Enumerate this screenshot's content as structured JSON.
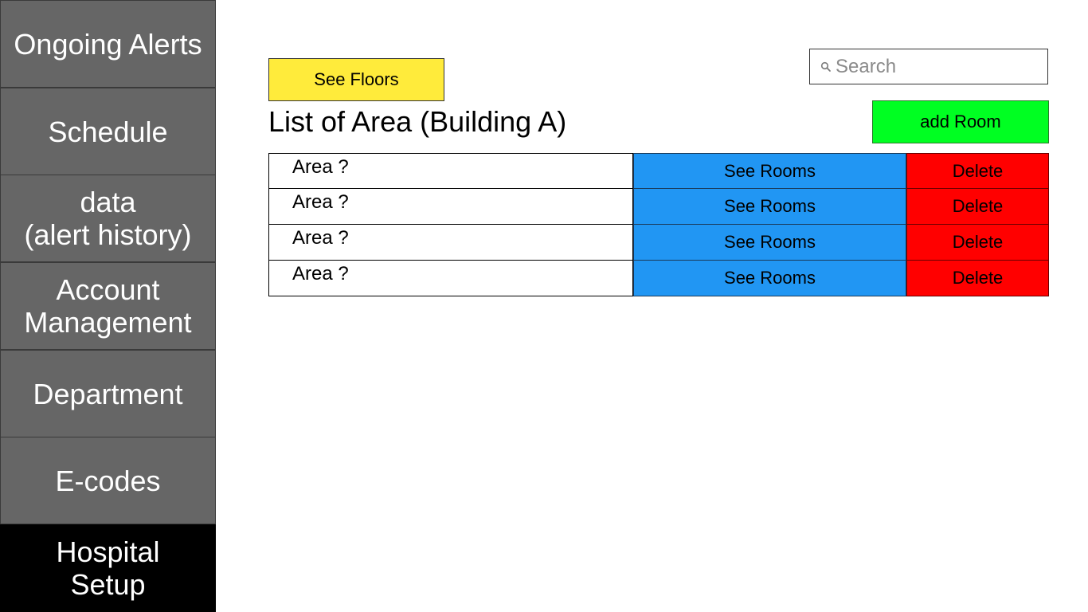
{
  "sidebar": {
    "items": [
      {
        "label": "Ongoing Alerts",
        "active": false
      },
      {
        "label": "Schedule",
        "active": false
      },
      {
        "label": "data\n(alert history)",
        "active": false
      },
      {
        "label": "Account\nManagement",
        "active": false
      },
      {
        "label": "Department",
        "active": false
      },
      {
        "label": "E-codes",
        "active": false
      },
      {
        "label": "Hospital\nSetup",
        "active": true
      }
    ]
  },
  "toolbar": {
    "see_floors_label": "See Floors",
    "add_room_label": "add Room"
  },
  "search": {
    "placeholder": "Search",
    "value": ""
  },
  "main": {
    "title": "List of Area (Building A)",
    "rows": [
      {
        "name": "Area ?",
        "see_label": "See Rooms",
        "delete_label": "Delete"
      },
      {
        "name": "Area ?",
        "see_label": "See Rooms",
        "delete_label": "Delete"
      },
      {
        "name": "Area ?",
        "see_label": "See Rooms",
        "delete_label": "Delete"
      },
      {
        "name": "Area ?",
        "see_label": "See Rooms",
        "delete_label": "Delete"
      }
    ]
  },
  "colors": {
    "sidebar_bg": "#666666",
    "sidebar_active_bg": "#000000",
    "see_floors_bg": "#ffeb3b",
    "add_room_bg": "#00ff22",
    "see_rooms_bg": "#2196f3",
    "delete_bg": "#ff0000"
  },
  "icons": {
    "search": "search-icon"
  }
}
